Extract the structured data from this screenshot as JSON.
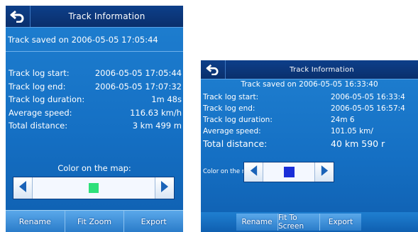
{
  "left_screen": {
    "title": "Track Information",
    "saved_text": "Track saved on 2006-05-05 17:05:44",
    "rows": [
      {
        "label": "Track log start:",
        "value": "2006-05-05 17:05:44"
      },
      {
        "label": "Track log end:",
        "value": "2006-05-05 17:07:32"
      },
      {
        "label": "Track log duration:",
        "value": "1m 48s"
      },
      {
        "label": "Average speed:",
        "value": "116.63 km/h"
      },
      {
        "label": "Total distance:",
        "value": "3 km 499 m"
      }
    ],
    "color_label": "Color on the map:",
    "swatch_color": "#2ee07a",
    "buttons": [
      "Rename",
      "Fit Zoom",
      "Export"
    ]
  },
  "right_screen": {
    "title": "Track Information",
    "saved_text": "Track saved on 2006-05-05 16:33:40",
    "rows": [
      {
        "label": "Track log start:",
        "value": "2006-05-05 16:33:4"
      },
      {
        "label": "Track log end:",
        "value": "2006-05-05 16:57:4"
      },
      {
        "label": "Track log duration:",
        "value": "24m 6"
      },
      {
        "label": "Average speed:",
        "value": "101.05 km/"
      },
      {
        "label": "Total distance:",
        "value": "40 km 590 r"
      }
    ],
    "color_label": "Color on the map:",
    "swatch_color": "#1a2ed8",
    "buttons": [
      "Rename",
      "Fit To Screen",
      "Export"
    ]
  },
  "icons": {
    "back": "back-arrow-icon",
    "left_arrow": "arrow-left-icon",
    "right_arrow": "arrow-right-icon"
  }
}
